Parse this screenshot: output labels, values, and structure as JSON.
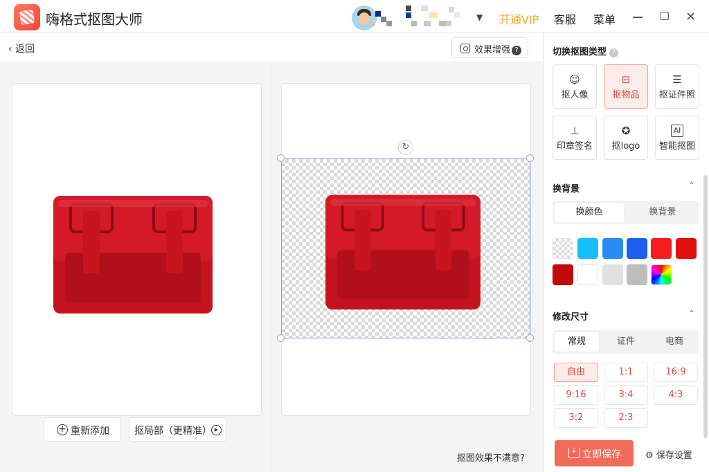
{
  "app": {
    "title": "嗨格式抠图大师"
  },
  "header": {
    "vip_label": "开通VIP",
    "service_label": "客服",
    "menu_label": "菜单",
    "dropdown_glyph": "▼"
  },
  "toolbar": {
    "back_label": "返回",
    "enhance_label": "效果增强",
    "help_glyph": "?"
  },
  "editor": {
    "readd_label": "重新添加",
    "local_label": "抠局部（更精准）",
    "unsatisfied_label": "抠图效果不满意?",
    "rotate_glyph": "↻"
  },
  "sidebar": {
    "type_title": "切换抠图类型",
    "help_glyph": "?",
    "types": [
      {
        "label": "抠人像",
        "icon": "person-icon",
        "glyph": "☺"
      },
      {
        "label": "抠物品",
        "icon": "box-icon",
        "glyph": "⊟"
      },
      {
        "label": "抠证件照",
        "icon": "id-card-icon",
        "glyph": "☰"
      },
      {
        "label": "印章签名",
        "icon": "stamp-icon",
        "glyph": "⊥"
      },
      {
        "label": "抠logo",
        "icon": "badge-icon",
        "glyph": "✪"
      },
      {
        "label": "智能抠图",
        "icon": "ai-icon",
        "glyph": "AI"
      }
    ],
    "active_type": "抠物品",
    "bg_title": "换背景",
    "bg_tabs": [
      "换颜色",
      "换背景"
    ],
    "size_title": "修改尺寸",
    "size_tabs": [
      "常规",
      "证件",
      "电商"
    ],
    "ratios": [
      "自由",
      "1:1",
      "16:9",
      "9:16",
      "3:4",
      "4:3",
      "3:2",
      "2:3"
    ],
    "save_label": "立即保存",
    "save_settings_label": "保存设置",
    "chevron_glyph": "⌃"
  },
  "colors": {
    "accent": "#f26a5a",
    "vip": "#f5a623",
    "selection": "#7aa7e6",
    "swatches": [
      "transparent",
      "#16c0f5",
      "#2a8cf0",
      "#1f5ff0",
      "#f51d1d",
      "#e01010",
      "#c20a0a",
      "#ffffff",
      "#e1e1e1",
      "#bfbcbc",
      "gradient"
    ]
  }
}
